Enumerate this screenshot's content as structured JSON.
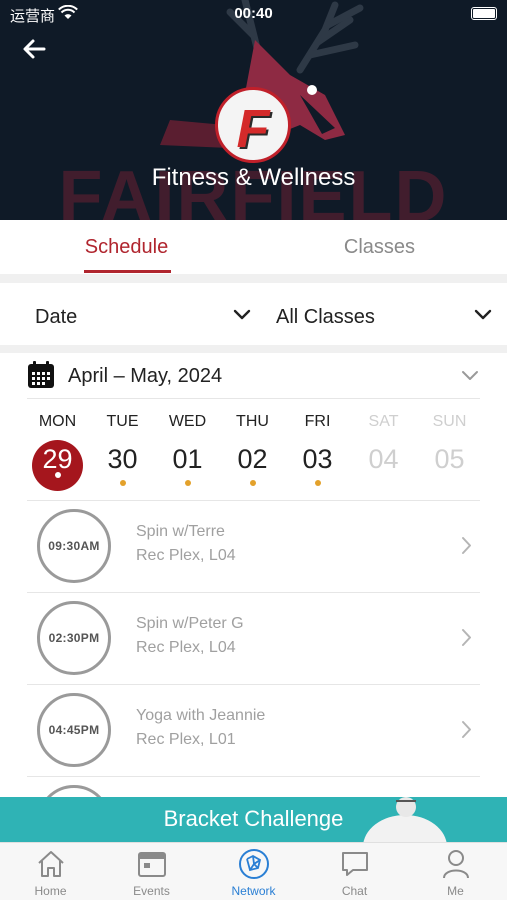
{
  "status_bar": {
    "carrier": "运营商",
    "time": "00:40"
  },
  "header": {
    "title": "Fitness & Wellness",
    "logo_letter": "F",
    "watermark": "FAIRFIELD"
  },
  "tabs": [
    {
      "label": "Schedule",
      "active": true
    },
    {
      "label": "Classes",
      "active": false
    }
  ],
  "filters": {
    "date_label": "Date",
    "classes_label": "All Classes"
  },
  "calendar": {
    "range": "April – May,  2024",
    "days": [
      {
        "name": "MON",
        "num": "29",
        "selected": true,
        "dot": true,
        "muted": false
      },
      {
        "name": "TUE",
        "num": "30",
        "selected": false,
        "dot": true,
        "muted": false
      },
      {
        "name": "WED",
        "num": "01",
        "selected": false,
        "dot": true,
        "muted": false
      },
      {
        "name": "THU",
        "num": "02",
        "selected": false,
        "dot": true,
        "muted": false
      },
      {
        "name": "FRI",
        "num": "03",
        "selected": false,
        "dot": true,
        "muted": false
      },
      {
        "name": "SAT",
        "num": "04",
        "selected": false,
        "dot": false,
        "muted": true
      },
      {
        "name": "SUN",
        "num": "05",
        "selected": false,
        "dot": false,
        "muted": true
      }
    ]
  },
  "classes": [
    {
      "time": "09:30AM",
      "name": "Spin w/Terre",
      "location": "Rec Plex, L04"
    },
    {
      "time": "02:30PM",
      "name": "Spin w/Peter G",
      "location": "Rec Plex, L04"
    },
    {
      "time": "04:45PM",
      "name": "Yoga with Jeannie",
      "location": "Rec Plex, L01"
    }
  ],
  "banner": {
    "text": "Bracket Challenge"
  },
  "nav": [
    {
      "label": "Home",
      "icon": "home-icon",
      "active": false
    },
    {
      "label": "Events",
      "icon": "calendar-icon",
      "active": false
    },
    {
      "label": "Network",
      "icon": "network-icon",
      "active": true
    },
    {
      "label": "Chat",
      "icon": "chat-icon",
      "active": false
    },
    {
      "label": "Me",
      "icon": "person-icon",
      "active": false
    }
  ],
  "colors": {
    "accent": "#b0252e",
    "selected_day": "#a5161d",
    "event_dot": "#e3a12b",
    "banner": "#2fb3b5",
    "nav_active": "#2a7fd4"
  }
}
